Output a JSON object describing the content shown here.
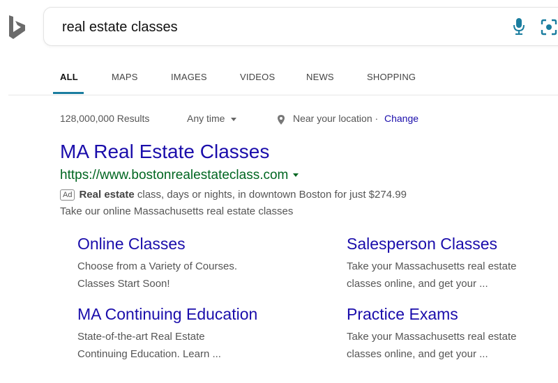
{
  "search": {
    "query": "real estate classes",
    "mic_icon": "microphone-icon",
    "visual_search_icon": "visual-search-icon",
    "accent_color": "#1a7d9f"
  },
  "tabs": [
    {
      "label": "ALL",
      "active": true
    },
    {
      "label": "MAPS"
    },
    {
      "label": "IMAGES"
    },
    {
      "label": "VIDEOS"
    },
    {
      "label": "NEWS"
    },
    {
      "label": "SHOPPING"
    }
  ],
  "filters": {
    "results_count": "128,000,000 Results",
    "time_filter": "Any time",
    "location_text": "Near your location ·",
    "change_label": "Change"
  },
  "ad": {
    "title": "MA Real Estate Classes",
    "url": "https://www.bostonrealestateclass.com",
    "badge": "Ad",
    "desc_bold": "Real estate",
    "desc_rest": " class, days or nights, in downtown Boston for just $274.99",
    "desc_line2": "Take our online Massachusetts real estate classes",
    "title_color": "#1a0dab",
    "url_color": "#006621"
  },
  "sitelinks": [
    {
      "title": "Online Classes",
      "line1": "Choose from a Variety of Courses.",
      "line2": "Classes Start Soon!"
    },
    {
      "title": "Salesperson Classes",
      "line1": "Take your Massachusetts real estate",
      "line2": "classes online, and get your ..."
    },
    {
      "title": "MA Continuing Education",
      "line1": "State-of-the-art Real Estate",
      "line2": "Continuing Education. Learn ..."
    },
    {
      "title": "Practice Exams",
      "line1": "Take your Massachusetts real estate",
      "line2": "classes online, and get your ..."
    }
  ]
}
